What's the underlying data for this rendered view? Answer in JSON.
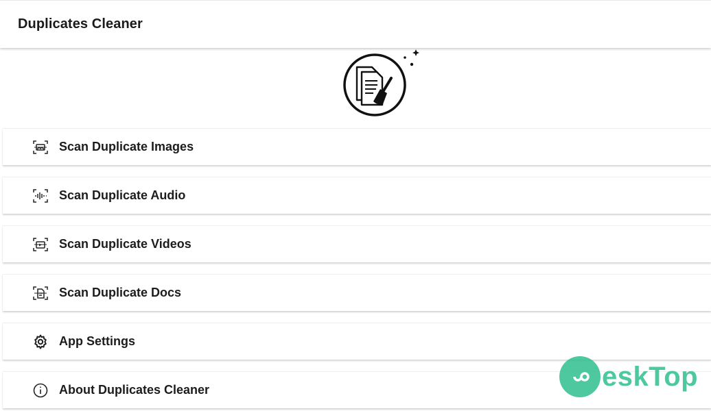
{
  "app_bar": {
    "title": "Duplicates Cleaner"
  },
  "logo": {
    "icon": "documents-broom-icon"
  },
  "menu": {
    "items": [
      {
        "label": "Scan Duplicate Images",
        "icon": "scan-image-icon"
      },
      {
        "label": "Scan Duplicate Audio",
        "icon": "scan-audio-icon"
      },
      {
        "label": "Scan Duplicate Videos",
        "icon": "scan-video-icon"
      },
      {
        "label": "Scan Duplicate Docs",
        "icon": "scan-doc-icon"
      },
      {
        "label": "App Settings",
        "icon": "gear-icon"
      },
      {
        "label": "About Duplicates Cleaner",
        "icon": "info-icon"
      }
    ]
  },
  "watermark": {
    "text": "eskTop"
  },
  "colors": {
    "text": "#1a1a1a",
    "watermark": "#2fbf8f",
    "background": "#ffffff"
  }
}
